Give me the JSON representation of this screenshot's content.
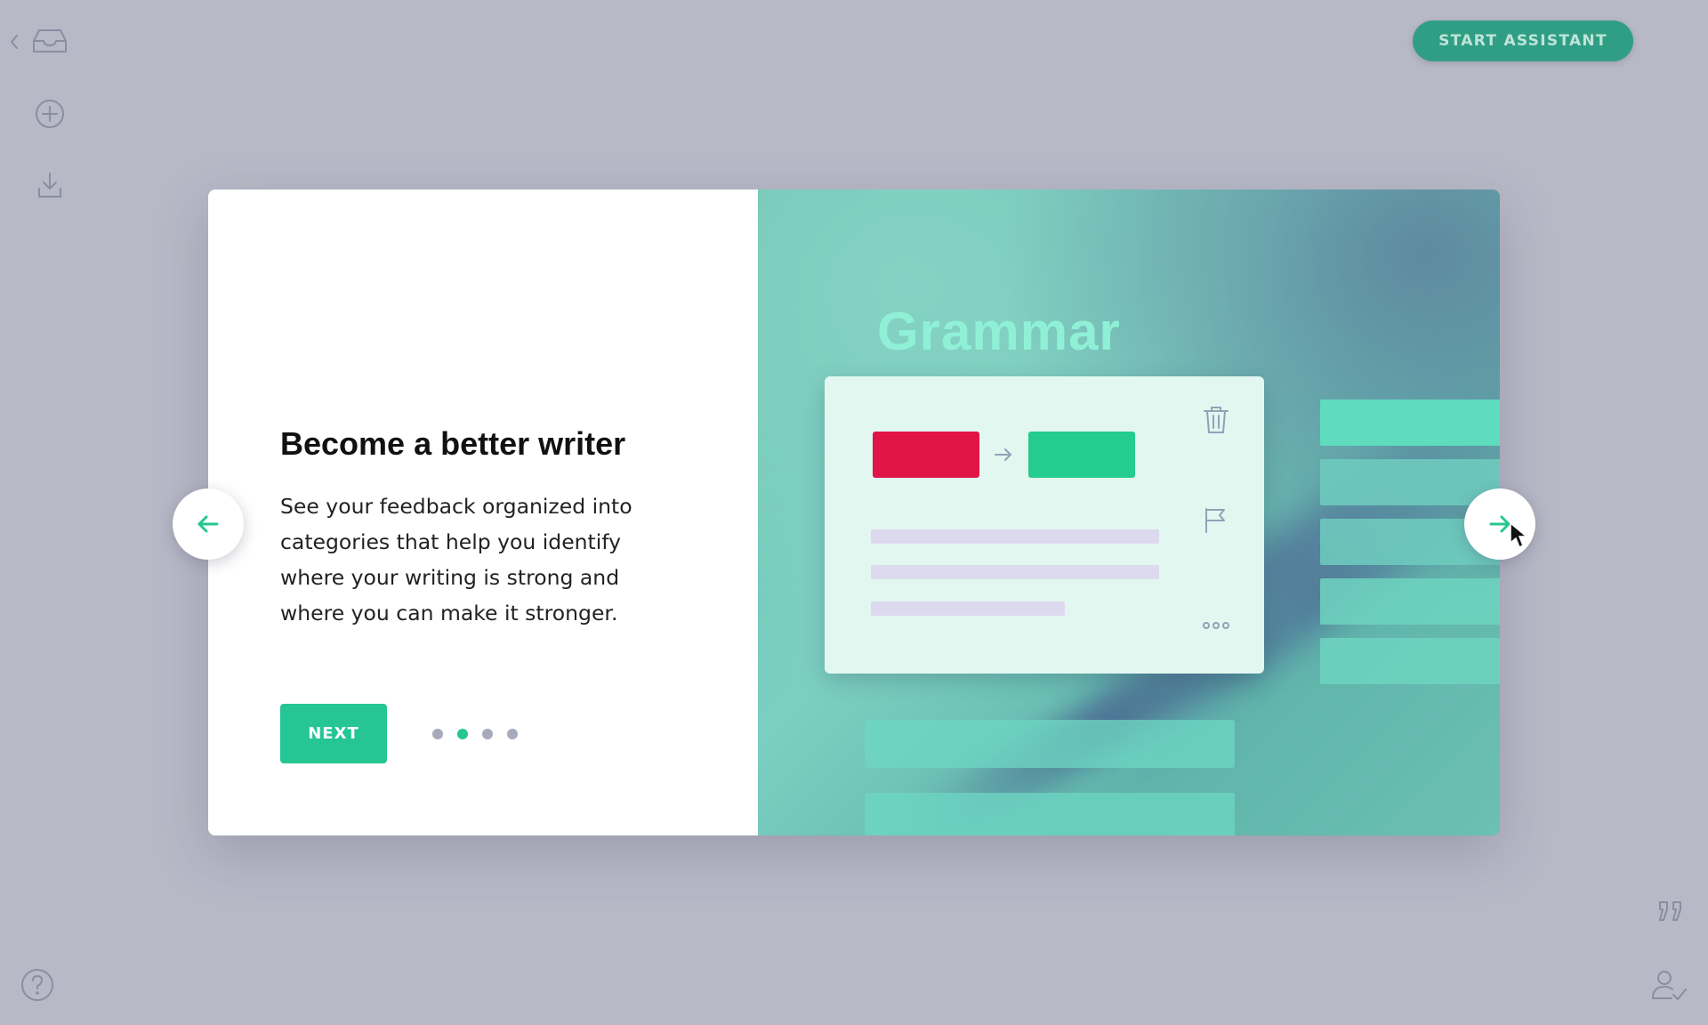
{
  "toolbar": {
    "start_assistant_label": "START ASSISTANT"
  },
  "modal": {
    "title": "Become a better writer",
    "description": "See your feedback organized into categories that help you identify where your writing is strong and where you can make it stronger.",
    "next_label": "NEXT",
    "pagination": {
      "total": 4,
      "active_index": 1
    },
    "illustration": {
      "heading": "Grammar"
    }
  },
  "icons": {
    "back": "chevron-left-icon",
    "documents": "inbox-icon",
    "new_document": "plus-circle-icon",
    "upload": "download-icon",
    "help": "question-icon",
    "quote": "quote-icon",
    "account": "user-check-icon"
  },
  "colors": {
    "accent": "#25c693",
    "start_button": "#2f9e85",
    "error_chip": "#e11448",
    "fix_chip": "#24cc90",
    "background": "#b8b9c7"
  }
}
